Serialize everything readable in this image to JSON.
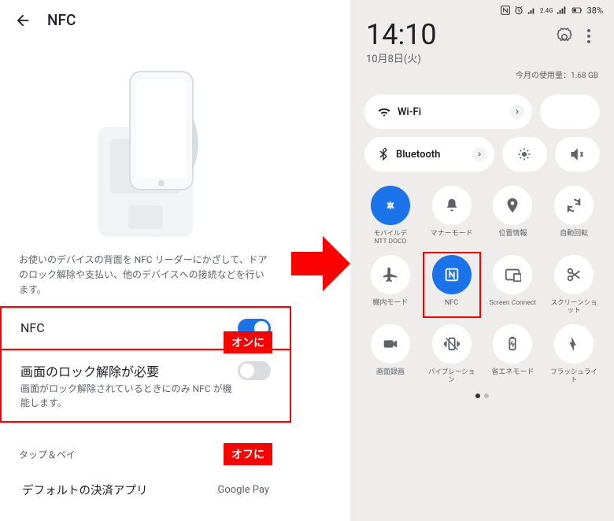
{
  "left": {
    "title": "NFC",
    "description": "お使いのデバイスの背面を NFC リーダーにかざして、ドアのロック解除や支払い、他のデバイスへの接続などを行います。",
    "setting1": {
      "label": "NFC",
      "on": true
    },
    "setting2": {
      "label": "画面のロック解除が必要",
      "sub": "画面がロック解除されているときにのみ NFC が機能します。",
      "on": false
    },
    "tag_on": "オンに",
    "tag_off": "オフに",
    "section": "タップ＆ペイ",
    "pay_label": "デフォルトの決済アプリ",
    "pay_value": "Google Pay"
  },
  "right": {
    "status": {
      "battery": "38%"
    },
    "time": "14:10",
    "date": "10月8日(火)",
    "usage": "今月の使用量：1.68 GB",
    "wifi": "Wi-Fi",
    "bt": "Bluetooth",
    "tiles": [
      {
        "label": "モバイルデータ",
        "sub": "NTT DOCOMO",
        "active": true,
        "icon": "data"
      },
      {
        "label": "マナーモード",
        "icon": "bell"
      },
      {
        "label": "位置情報",
        "icon": "location"
      },
      {
        "label": "自動回転",
        "icon": "rotate"
      },
      {
        "label": "機内モード",
        "icon": "plane"
      },
      {
        "label": "NFC",
        "active": true,
        "highlight": true,
        "icon": "nfc"
      },
      {
        "label": "Screen Connect",
        "icon": "cast"
      },
      {
        "label": "スクリーンショット",
        "icon": "scissors"
      },
      {
        "label": "画面録画",
        "icon": "record"
      },
      {
        "label": "バイブレーション",
        "icon": "vibrate"
      },
      {
        "label": "省エネモード",
        "icon": "battery"
      },
      {
        "label": "フラッシュライト",
        "icon": "flash"
      }
    ]
  }
}
